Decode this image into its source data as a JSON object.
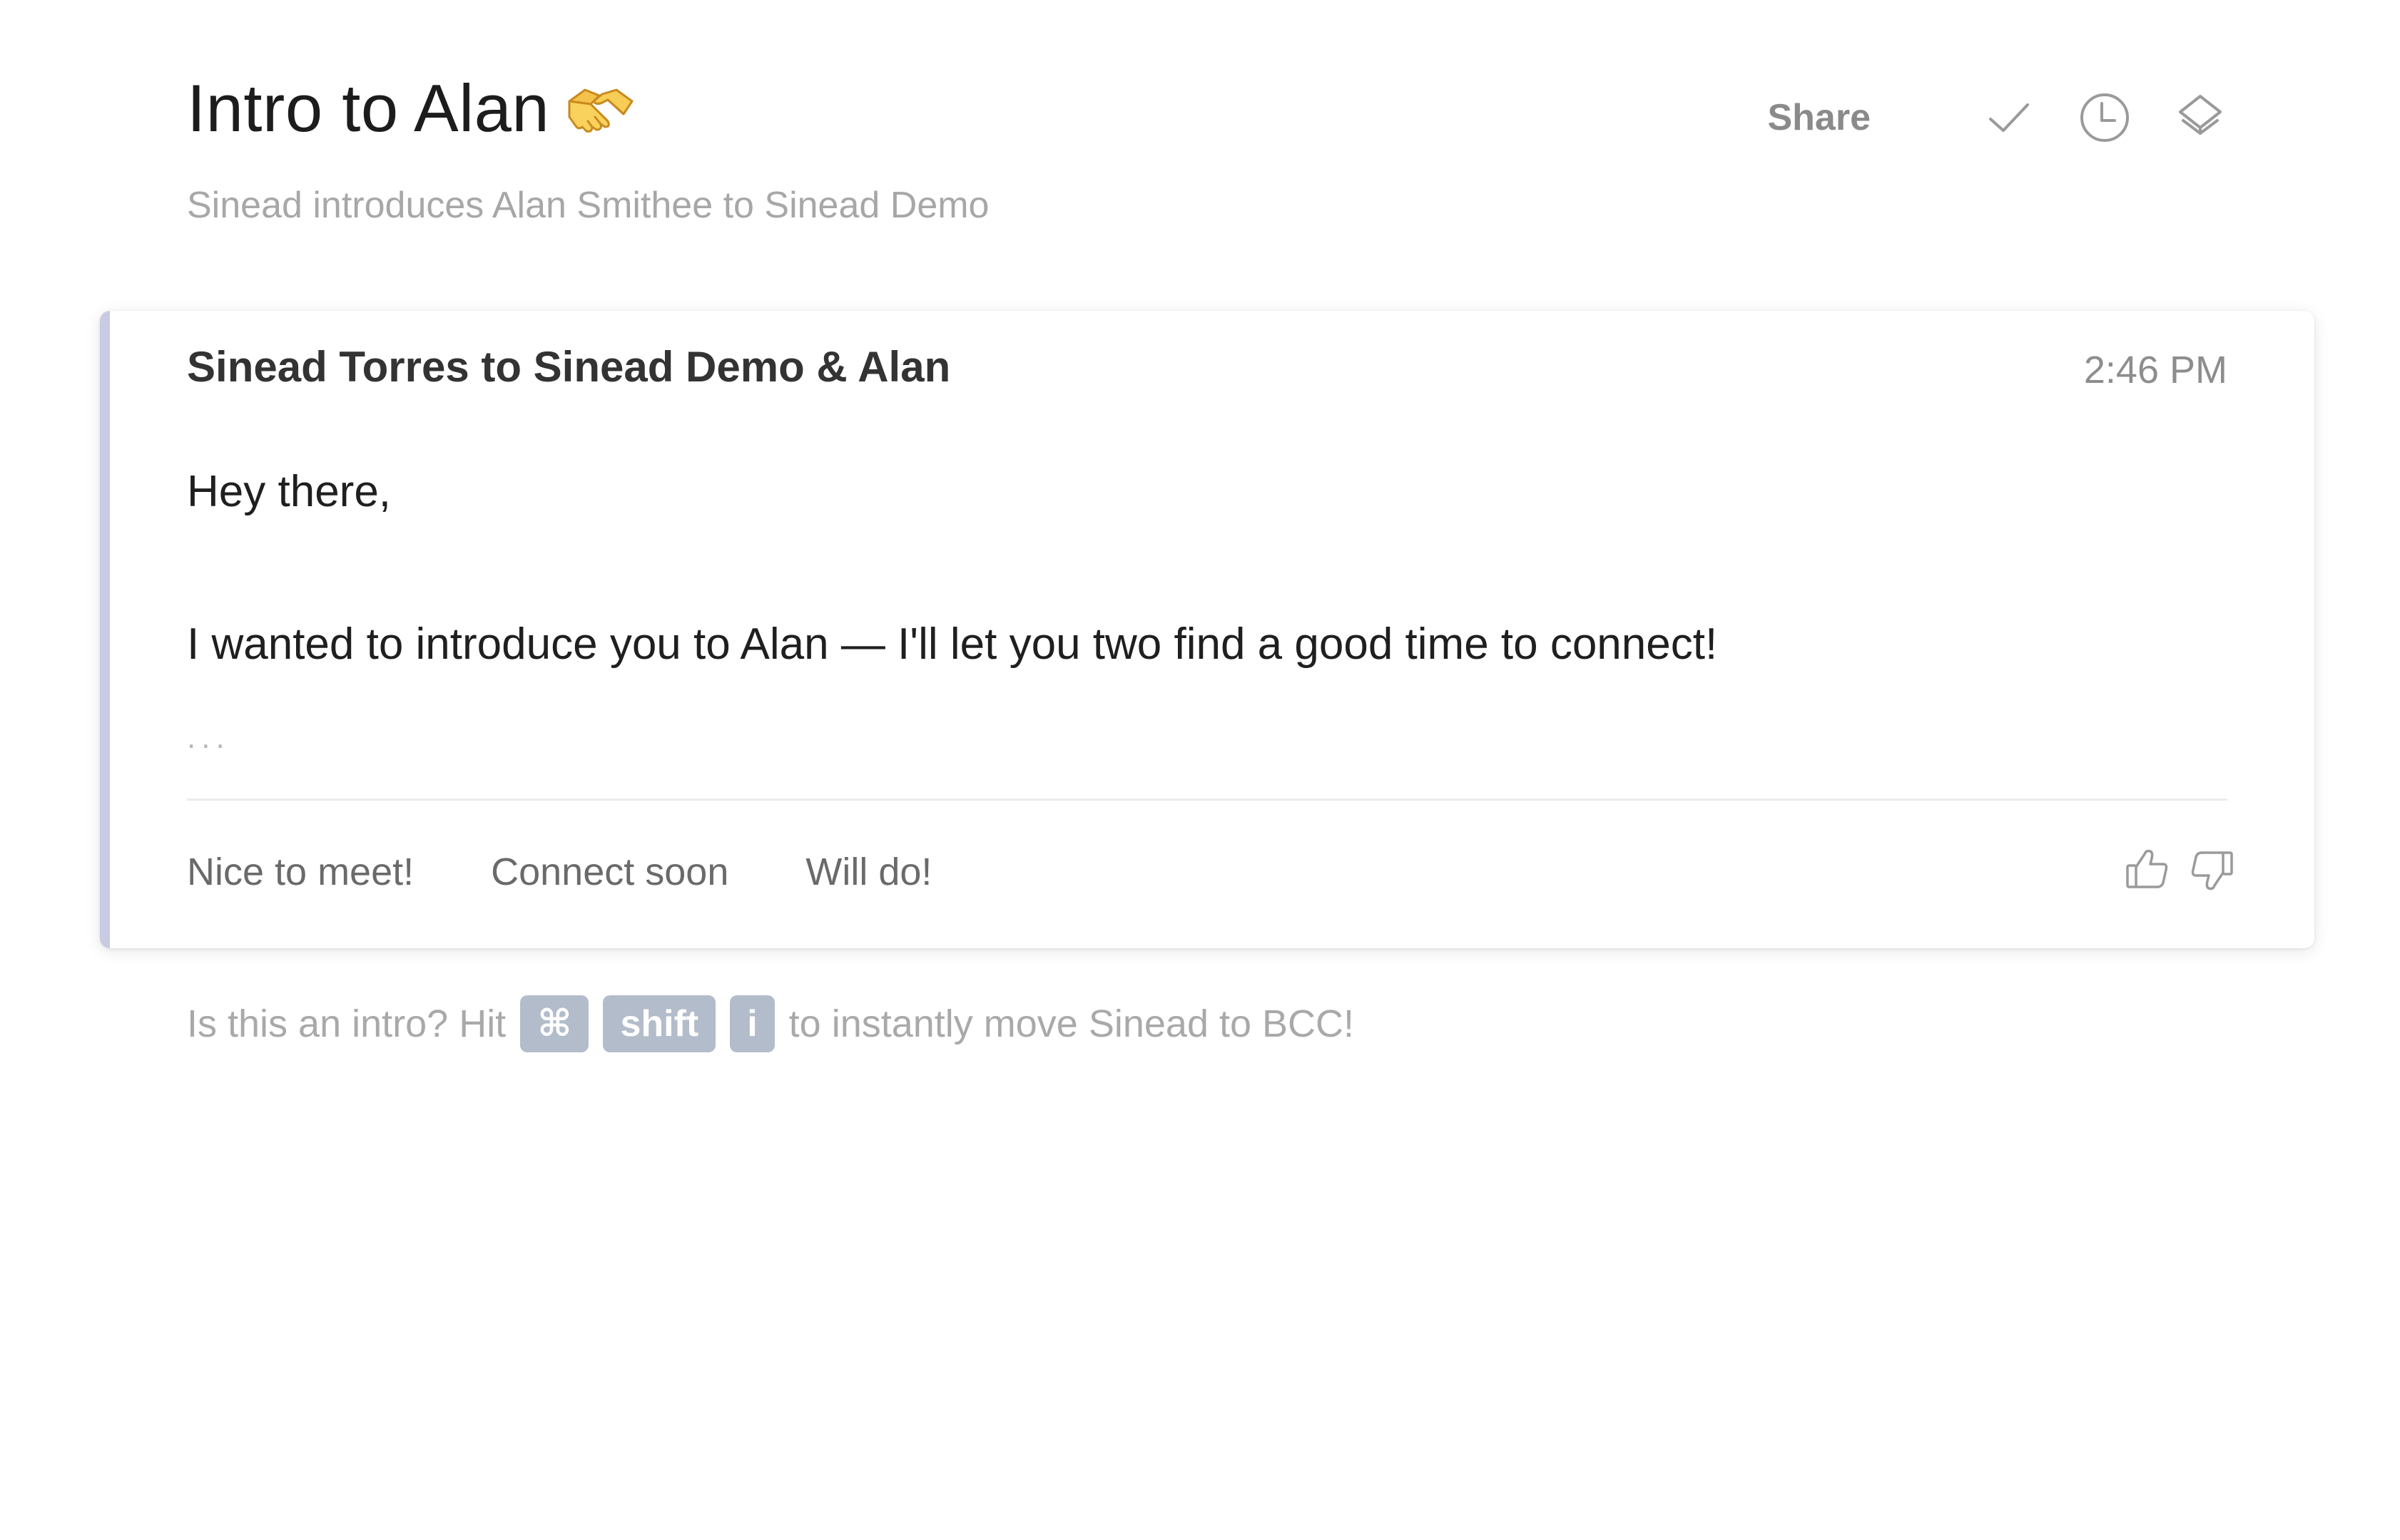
{
  "header": {
    "title": "Intro to Alan",
    "subtitle": "Sinead introduces Alan Smithee to Sinead Demo",
    "share_label": "Share",
    "title_emoji_icon": "handshake-icon"
  },
  "toolbar": {
    "icons": [
      "check-icon",
      "clock-icon",
      "layers-icon"
    ]
  },
  "message": {
    "from_line": "Sinead Torres to Sinead Demo & Alan",
    "time": "2:46 PM",
    "greeting": "Hey there,",
    "body": "I wanted to introduce you to Alan — I'll let you two find a good time to connect!",
    "ellipsis": "...",
    "quick_replies": [
      "Nice to meet!",
      "Connect soon",
      "Will do!"
    ],
    "feedback_icons": [
      "thumbs-up-icon",
      "thumbs-down-icon"
    ],
    "accent_color": "#c9cbe3"
  },
  "hint": {
    "prefix": "Is this an intro? Hit",
    "keys": [
      "⌘",
      "shift",
      "i"
    ],
    "suffix": "to instantly move Sinead to BCC!",
    "key_color": "#b3bcca"
  }
}
